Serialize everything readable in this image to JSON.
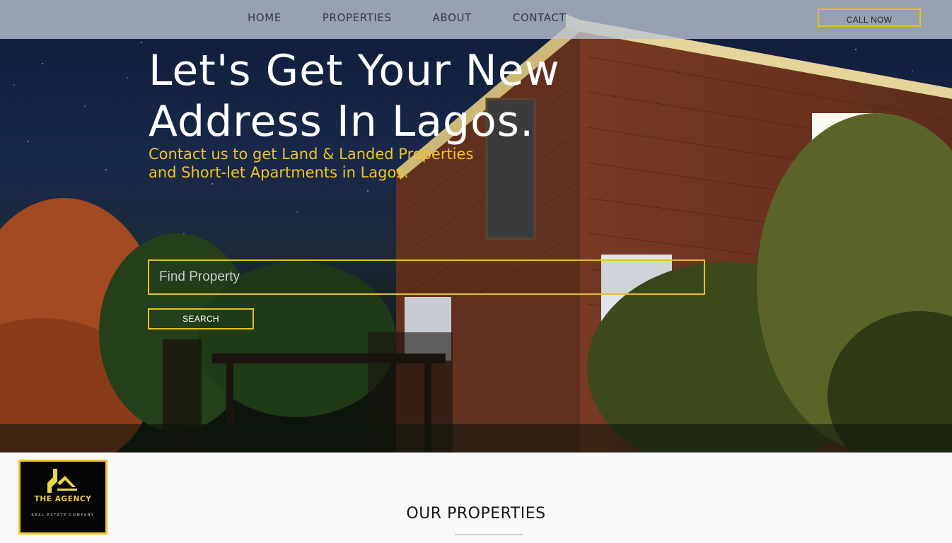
{
  "nav": {
    "links": [
      "HOME",
      "PROPERTIES",
      "ABOUT",
      "CONTACT"
    ],
    "cta_label": "CALL NOW"
  },
  "hero": {
    "headline_line1": "Let's Get Your New",
    "headline_line2": "Address In Lagos.",
    "subheadline": "Contact us to get Land & Landed Properties and Short-let Apartments in Lagos.",
    "search_placeholder": "Find Property",
    "search_button_label": "SEARCH"
  },
  "logo": {
    "name": "THE AGENCY",
    "tagline": "REAL ESTATE COMPANY"
  },
  "section": {
    "title": "OUR PROPERTIES"
  },
  "colors": {
    "accent": "#e6c21c",
    "nav_bar": "#bec6d4",
    "headline": "#ffffff",
    "subheadline": "#f3c51e",
    "logo_background": "#050505"
  },
  "icons": [
    "house-roof-logo-icon"
  ]
}
